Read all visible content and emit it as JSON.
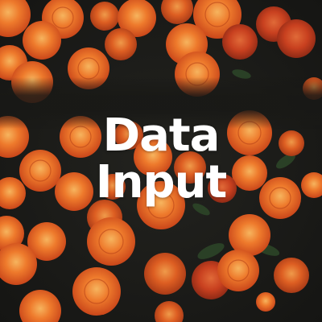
{
  "title": {
    "line1": "Data",
    "line2": "Input"
  },
  "colors": {
    "background": "#1b1b18",
    "flower_outer": "#d9551a",
    "flower_mid": "#ee7a2c",
    "flower_inner": "#f4a14c",
    "leaf": "#2f4a2a",
    "text": "#ffffff"
  }
}
